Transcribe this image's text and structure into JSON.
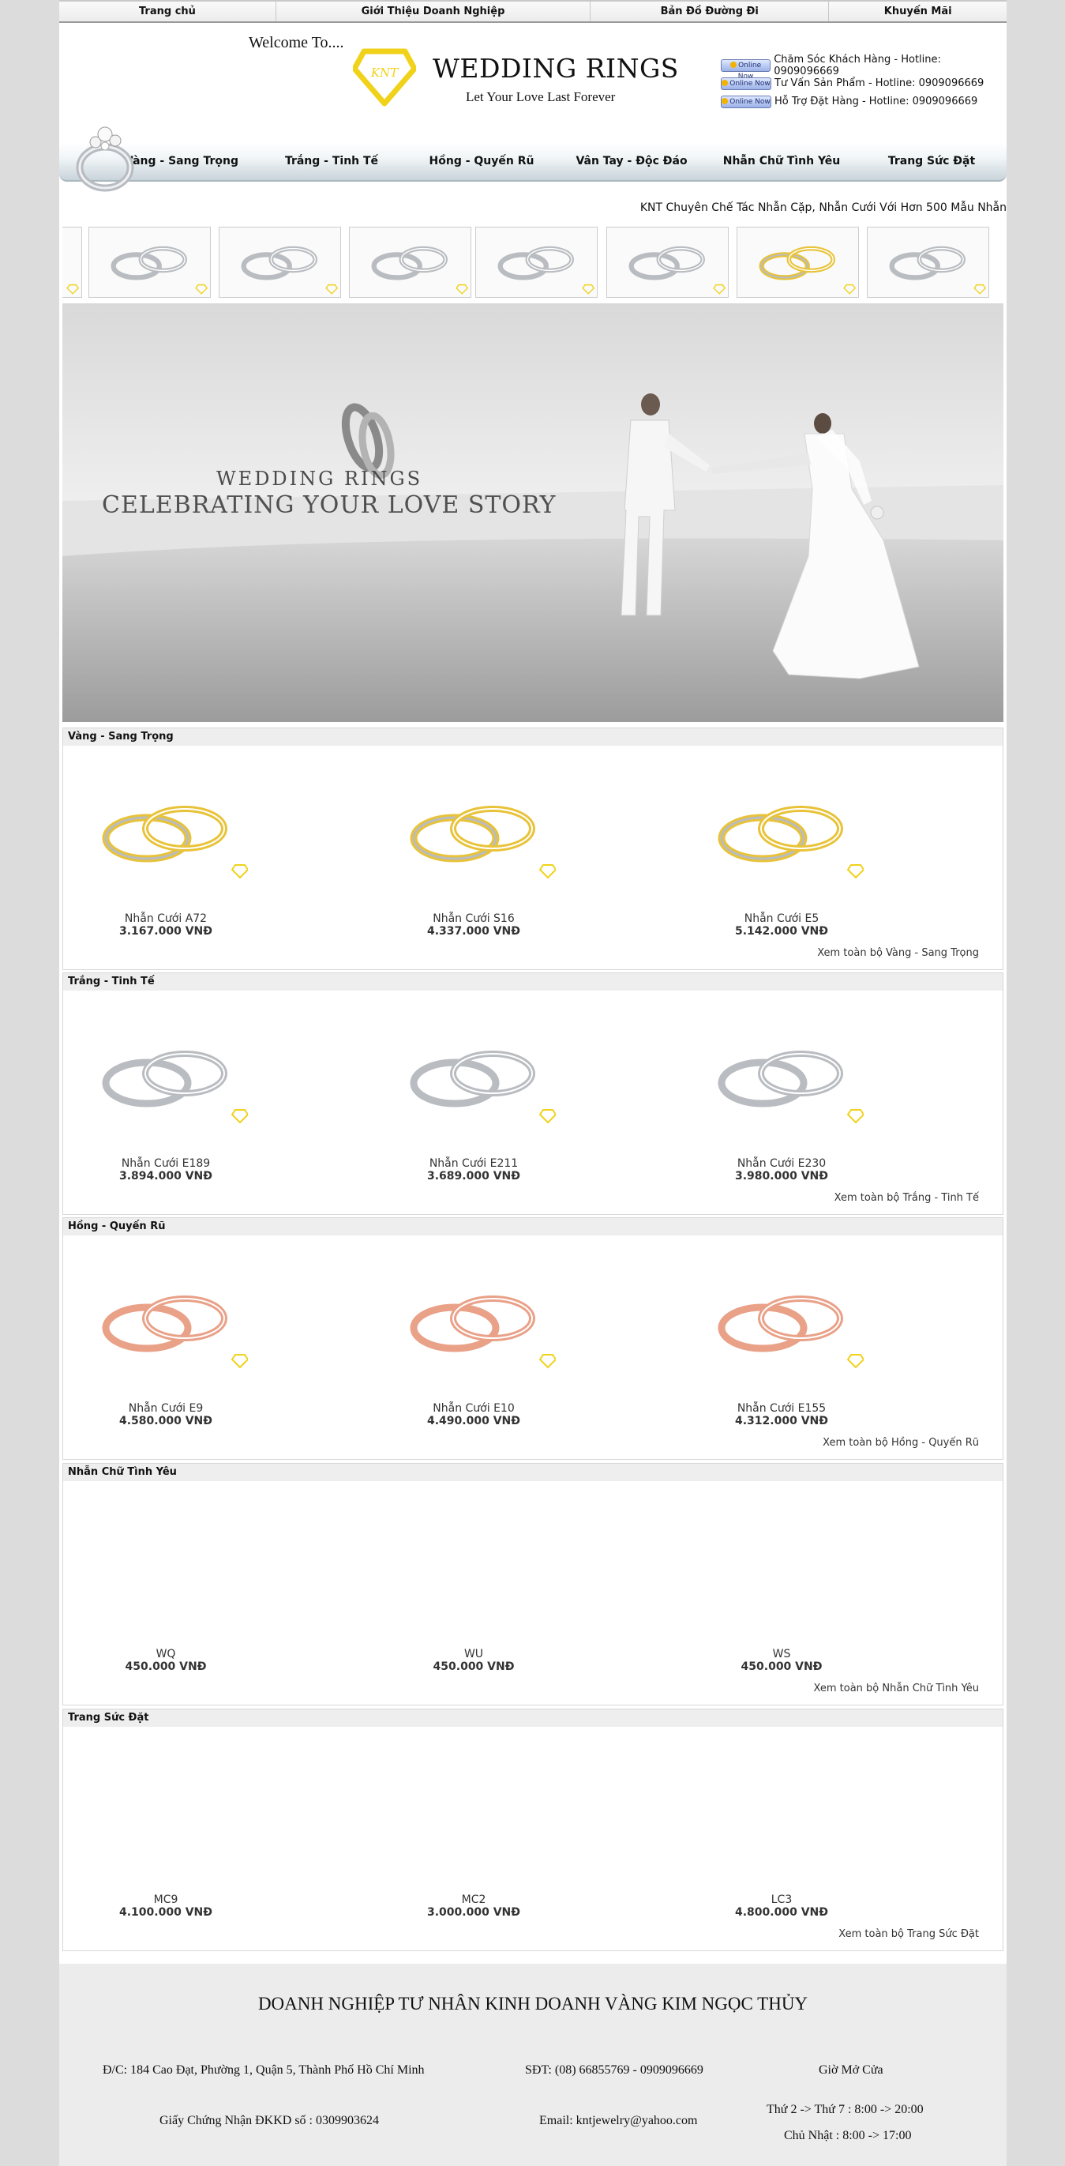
{
  "top_nav": [
    "Trang chủ",
    "Giới Thiệu Doanh Nghiệp",
    "Bản Đồ Đường Đi",
    "Khuyến Mãi"
  ],
  "header": {
    "welcome": "Welcome To....",
    "logo_text": "KNT",
    "brand": "WEDDING RINGS",
    "tagline": "Let Your Love Last Forever",
    "online_label": "Online Now",
    "hotlines": [
      "Chăm Sóc Khách Hàng - Hotline: 0909096669",
      "Tư Vấn Sản Phẩm - Hotline: 0909096669",
      "Hỗ Trợ Đặt Hàng - Hotline: 0909096669"
    ]
  },
  "main_menu": [
    "Vàng - Sang Trọng",
    "Trắng - Tinh Tế",
    "Hồng - Quyến Rũ",
    "Vân Tay - Độc Đáo",
    "Nhẫn Chữ Tình Yêu",
    "Trang Sức Đặt"
  ],
  "marquee": "KNT Chuyên Chế Tác Nhẫn Cặp, Nhẫn Cưới Với Hơn 500 Mẫu Nhẫn",
  "thumbnails": [
    "gold",
    "silver",
    "silver",
    "silver",
    "silver",
    "silver",
    "gold",
    "silver"
  ],
  "banner": {
    "line1": "WEDDING RINGS",
    "line2": "CELEBRATING YOUR LOVE STORY"
  },
  "sections": [
    {
      "title": "Vàng - Sang Trọng",
      "tone": "gold",
      "view_all": "Xem toàn bộ Vàng - Sang Trọng",
      "products": [
        {
          "name": "Nhẫn Cưới A72",
          "price": "3.167.000 VNĐ"
        },
        {
          "name": "Nhẫn Cưới S16",
          "price": "4.337.000 VNĐ"
        },
        {
          "name": "Nhẫn Cưới E5",
          "price": "5.142.000 VNĐ"
        }
      ]
    },
    {
      "title": "Trắng - Tinh Tế",
      "tone": "silver",
      "view_all": "Xem toàn bộ Trắng - Tinh Tế",
      "products": [
        {
          "name": "Nhẫn Cưới E189",
          "price": "3.894.000 VNĐ"
        },
        {
          "name": "Nhẫn Cưới E211",
          "price": "3.689.000 VNĐ"
        },
        {
          "name": "Nhẫn Cưới E230",
          "price": "3.980.000 VNĐ"
        }
      ]
    },
    {
      "title": "Hồng - Quyến Rũ",
      "tone": "rose",
      "view_all": "Xem toàn bộ Hồng - Quyến Rũ",
      "products": [
        {
          "name": "Nhẫn Cưới E9",
          "price": "4.580.000 VNĐ"
        },
        {
          "name": "Nhẫn Cưới E10",
          "price": "4.490.000 VNĐ"
        },
        {
          "name": "Nhẫn Cưới E155",
          "price": "4.312.000 VNĐ"
        }
      ]
    },
    {
      "title": "Nhẫn Chữ Tình Yêu",
      "tone": "none",
      "view_all": "Xem toàn bộ Nhẫn Chữ Tình Yêu",
      "products": [
        {
          "name": "WQ",
          "price": "450.000 VNĐ"
        },
        {
          "name": "WU",
          "price": "450.000 VNĐ"
        },
        {
          "name": "WS",
          "price": "450.000 VNĐ"
        }
      ]
    },
    {
      "title": "Trang Sức Đặt",
      "tone": "none",
      "view_all": "Xem toàn bộ Trang Sức Đặt",
      "products": [
        {
          "name": "MC9",
          "price": "4.100.000 VNĐ"
        },
        {
          "name": "MC2",
          "price": "3.000.000 VNĐ"
        },
        {
          "name": "LC3",
          "price": "4.800.000 VNĐ"
        }
      ]
    }
  ],
  "footer": {
    "company": "DOANH NGHIỆP TƯ NHÂN KINH DOANH VÀNG KIM NGỌC THỦY",
    "address": "Đ/C: 184 Cao Đạt, Phường 1, Quận 5, Thành Phố Hồ Chí Minh",
    "phone": "SĐT: (08) 66855769 - 0909096669",
    "hours_title": "Giờ Mở Cửa",
    "license": "Giấy Chứng Nhận ĐKKD số : 0309903624",
    "email": "Email: kntjewelry@yahoo.com",
    "hours_weekday": "Thứ 2 -> Thứ 7 : 8:00 -> 20:00",
    "hours_sunday": "Chủ Nhật : 8:00 -> 17:00"
  },
  "colors": {
    "gold": "#e8c33a",
    "silver": "#b9bcc0",
    "rose": "#e9a188",
    "logo_yellow": "#f0d21a"
  }
}
